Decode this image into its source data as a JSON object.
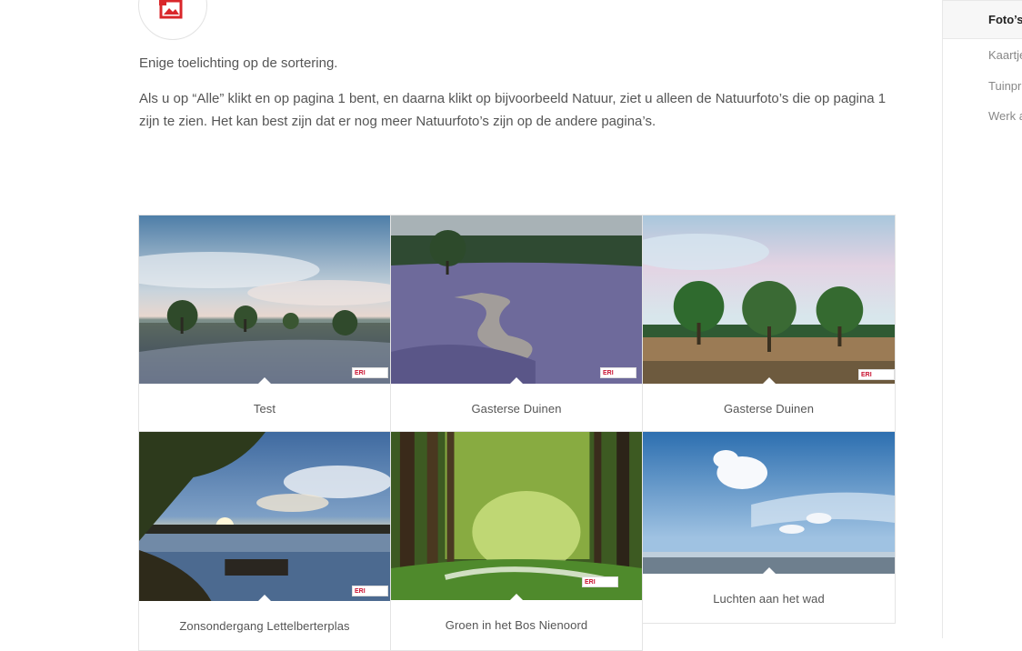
{
  "intro": {
    "line1": "Enige toelichting op de sortering.",
    "line2": "Als u op “Alle” klikt en op pagina 1 bent, en daarna klikt op bijvoorbeeld Natuur, ziet u alleen de Natuurfoto’s  die op pagina 1 zijn te zien. Het kan best zijn dat er nog meer Natuurfoto’s  zijn op de andere pagina’s."
  },
  "page_icon": {
    "name": "photos-icon",
    "color": "#d9262a"
  },
  "gallery": {
    "items": [
      {
        "caption": "Test",
        "watermark": "ERI"
      },
      {
        "caption": "Gasterse Duinen",
        "watermark": "ERI"
      },
      {
        "caption": "Gasterse Duinen",
        "watermark": "ERI"
      },
      {
        "caption": "Zonsondergang Lettelberterplas",
        "watermark": "ERI"
      },
      {
        "caption": "Groen in het Bos Nienoord",
        "watermark": "ERI"
      },
      {
        "caption": "Luchten aan het wad",
        "watermark": ""
      }
    ]
  },
  "sidebar": {
    "items": [
      {
        "label": "Foto’s"
      },
      {
        "label": "Kaartjes"
      },
      {
        "label": "Tuinpr"
      },
      {
        "label": "Werk a"
      }
    ]
  }
}
